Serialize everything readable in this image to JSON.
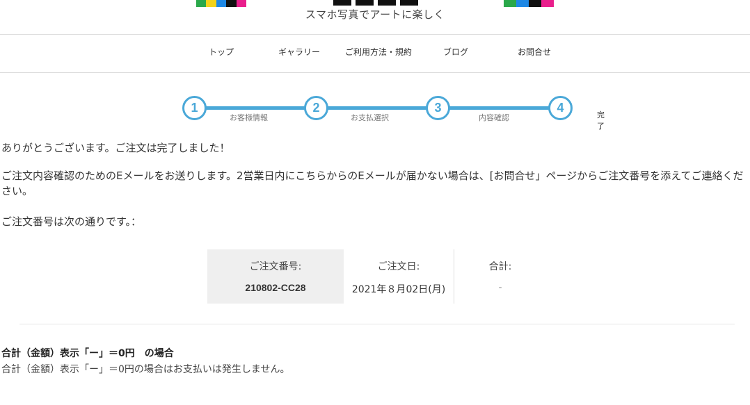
{
  "header": {
    "tagline": "スマホ写真でアートに楽しく",
    "logo_colors": [
      "#2aa84a",
      "#f3d31a",
      "#1e88e5",
      "#111111",
      "#e91e8c"
    ]
  },
  "nav": {
    "items": [
      "トップ",
      "ギャラリー",
      "ご利用方法・規約",
      "ブログ",
      "お問合せ"
    ]
  },
  "steps": {
    "items": [
      {
        "number": "1",
        "label": "お客様情報"
      },
      {
        "number": "2",
        "label": "お支払選択"
      },
      {
        "number": "3",
        "label": "内容確認"
      },
      {
        "number": "4",
        "label": "完了"
      }
    ],
    "accent_color": "#4aa8d8"
  },
  "message": {
    "thanks": "ありがとうございます。ご注文は完了しました！",
    "email_notice": "ご注文内容確認のためのEメールをお送りします。2営業日内にこちらからのEメールが届かない場合は、[お問合せ」ページからご注文番号を添えてご連絡ください。",
    "order_intro": "ご注文番号は次の通りです。："
  },
  "order": {
    "number_label": "ご注文番号:",
    "number_value": "210802-CC28",
    "date_label": "ご注文日:",
    "date_value": "2021年８月02日(月)",
    "total_label": "合計:",
    "total_value": "-"
  },
  "note": {
    "title": "合計（金額）表示「ー」＝0円　の場合",
    "text": "合計（金額）表示「ー」＝0円の場合はお支払いは発生しません。"
  }
}
